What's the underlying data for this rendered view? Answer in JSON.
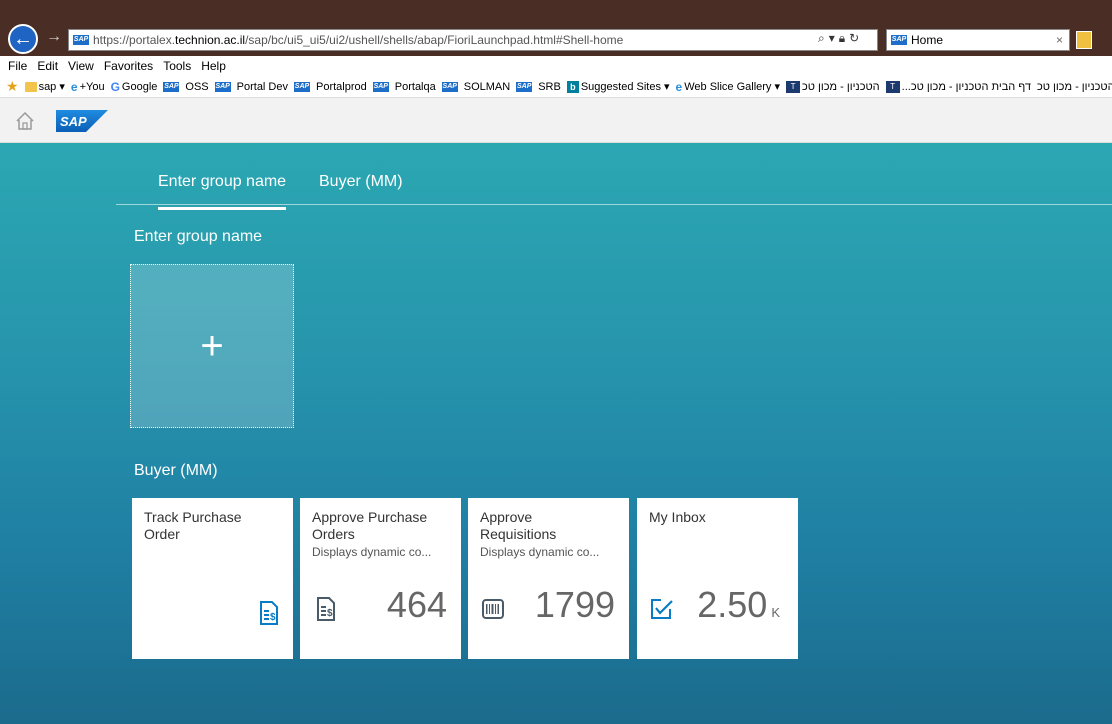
{
  "browser": {
    "url_prefix": "https://portalex.",
    "url_domain": "technion.ac.il",
    "url_path": "/sap/bc/ui5_ui5/ui2/ushell/shells/abap/FioriLaunchpad.html#Shell-home",
    "tab_title": "Home",
    "menu": [
      "File",
      "Edit",
      "View",
      "Favorites",
      "Tools",
      "Help"
    ],
    "favorites": [
      {
        "label": "sap ▾",
        "icon": "folder-icon"
      },
      {
        "label": "+You",
        "icon": "ie-icon"
      },
      {
        "label": "Google",
        "icon": "g-icon"
      },
      {
        "label": "OSS",
        "icon": "sap-icon"
      },
      {
        "label": "Portal Dev",
        "icon": "sap-icon"
      },
      {
        "label": "Portalprod",
        "icon": "sap-icon"
      },
      {
        "label": "Portalqa",
        "icon": "sap-icon"
      },
      {
        "label": "SOLMAN",
        "icon": "sap-icon"
      },
      {
        "label": "SRB",
        "icon": "sap-icon"
      },
      {
        "label": "Suggested Sites ▾",
        "icon": "bing-icon"
      },
      {
        "label": "Web Slice Gallery ▾",
        "icon": "ie-icon"
      },
      {
        "label": "הטכניון - מכון טכ",
        "icon": "tech-icon"
      },
      {
        "label": "...דף הבית הטכניון - מכון טכ",
        "icon": "tech-icon"
      },
      {
        "label": "דף הבית הטכניון - מכון טכ",
        "icon": "tech-icon"
      }
    ]
  },
  "shell": {
    "logo_text": "SAP"
  },
  "anchor_bar": {
    "items": [
      {
        "label": "Enter group name",
        "selected": true
      },
      {
        "label": "Buyer (MM)",
        "selected": false
      }
    ]
  },
  "groups": [
    {
      "title": "Enter group name",
      "add_tile_symbol": "+"
    },
    {
      "title": "Buyer (MM)"
    }
  ],
  "tiles": [
    {
      "title": "Track Purchase Order",
      "subtitle": "",
      "number": "",
      "unit": "",
      "icon": "document-dollar-icon"
    },
    {
      "title": "Approve Purchase Orders",
      "subtitle": "Displays dynamic co...",
      "number": "464",
      "unit": "",
      "icon": "document-dollar-icon"
    },
    {
      "title": "Approve Requisitions",
      "subtitle": "Displays dynamic co...",
      "number": "1799",
      "unit": "",
      "icon": "barcode-icon"
    },
    {
      "title": "My Inbox",
      "subtitle": "",
      "number": "2.50",
      "unit": "K",
      "icon": "inbox-check-icon"
    }
  ],
  "colors": {
    "accent": "#0a7bc6",
    "icon_dark": "#4a5a66"
  }
}
